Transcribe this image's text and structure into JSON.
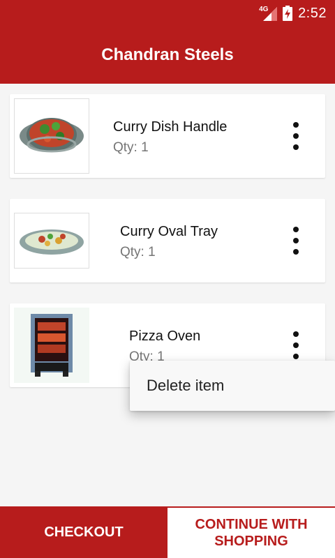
{
  "status_bar": {
    "network_label": "4G",
    "time": "2:52",
    "icons": [
      "signal-icon",
      "battery-charging-icon"
    ]
  },
  "app_bar": {
    "title": "Chandran Steels"
  },
  "cart": {
    "items": [
      {
        "name": "Curry Dish Handle",
        "qty": "Qty: 1",
        "image": "curry-dish-image"
      },
      {
        "name": "Curry Oval Tray",
        "qty": "Qty: 1",
        "image": "curry-oval-tray-image"
      },
      {
        "name": "Pizza Oven",
        "qty": "Qty: 1",
        "image": "pizza-oven-image"
      }
    ]
  },
  "popup_menu": {
    "items": [
      "Delete item"
    ]
  },
  "buttons": {
    "checkout": "CHECKOUT",
    "continue": "CONTINUE WITH SHOPPING"
  },
  "colors": {
    "primary": "#b71c1c",
    "background": "#f5f5f5"
  }
}
